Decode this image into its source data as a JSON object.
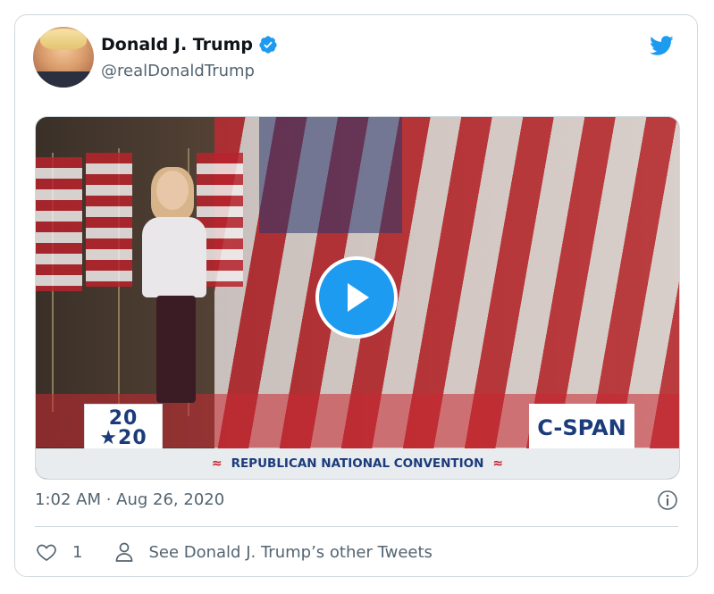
{
  "tweet": {
    "display_name": "Donald J. Trump",
    "handle": "@realDonaldTrump",
    "timestamp": "1:02 AM · Aug 26, 2020",
    "like_count": "1",
    "see_more_label": "See Donald J. Trump’s other Tweets"
  },
  "media": {
    "logo_left": [
      "20",
      "★20"
    ],
    "logo_right": "C-SPAN",
    "banner_text": "REPUBLICAN NATIONAL CONVENTION"
  },
  "colors": {
    "accent": "#1d9bf0",
    "text_primary": "#0f1419",
    "text_secondary": "#536471",
    "border": "#cfd9de"
  },
  "icons": [
    "verified-badge-icon",
    "twitter-bird-icon",
    "play-icon",
    "info-icon",
    "heart-icon",
    "person-icon"
  ]
}
